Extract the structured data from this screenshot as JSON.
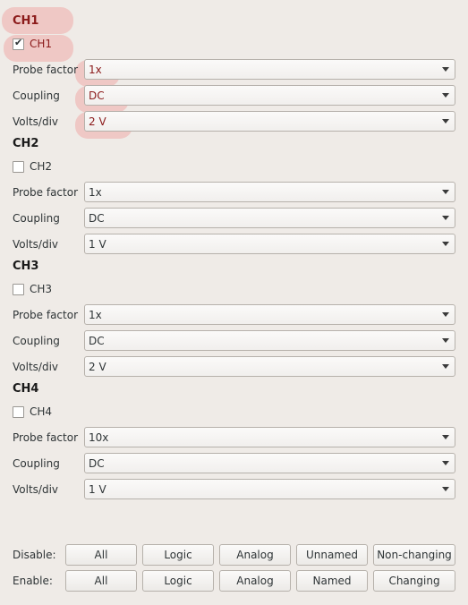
{
  "channels": [
    {
      "title": "CH1",
      "checkbox_label": "CH1",
      "checked": true,
      "probe_label": "Probe factor",
      "probe_value": "1x",
      "coupling_label": "Coupling",
      "coupling_value": "DC",
      "volts_label": "Volts/div",
      "volts_value": "2 V"
    },
    {
      "title": "CH2",
      "checkbox_label": "CH2",
      "checked": false,
      "probe_label": "Probe factor",
      "probe_value": "1x",
      "coupling_label": "Coupling",
      "coupling_value": "DC",
      "volts_label": "Volts/div",
      "volts_value": "1 V"
    },
    {
      "title": "CH3",
      "checkbox_label": "CH3",
      "checked": false,
      "probe_label": "Probe factor",
      "probe_value": "1x",
      "coupling_label": "Coupling",
      "coupling_value": "DC",
      "volts_label": "Volts/div",
      "volts_value": "2 V"
    },
    {
      "title": "CH4",
      "checkbox_label": "CH4",
      "checked": false,
      "probe_label": "Probe factor",
      "probe_value": "10x",
      "coupling_label": "Coupling",
      "coupling_value": "DC",
      "volts_label": "Volts/div",
      "volts_value": "1 V"
    }
  ],
  "disable": {
    "label": "Disable:",
    "buttons": [
      "All",
      "Logic",
      "Analog",
      "Unnamed",
      "Non-changing"
    ]
  },
  "enable": {
    "label": "Enable:",
    "buttons": [
      "All",
      "Logic",
      "Analog",
      "Named",
      "Changing"
    ]
  },
  "colors": {
    "highlight": "#f06e6e",
    "highlight_text": "#8b1a1a",
    "background": "#efebe7"
  }
}
